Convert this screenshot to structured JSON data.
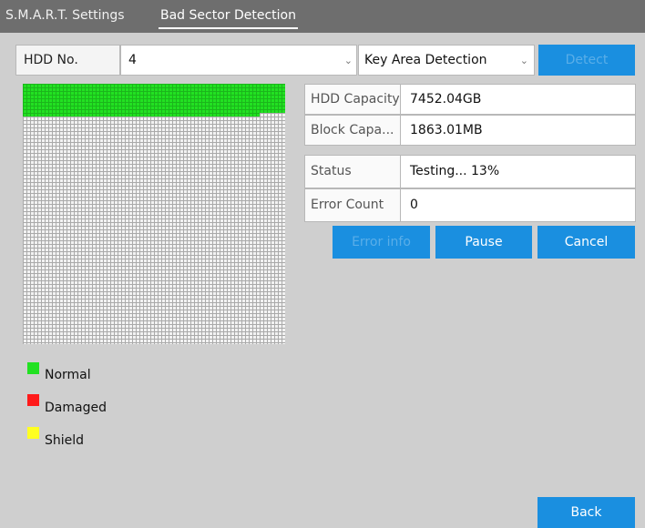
{
  "tabs": [
    {
      "label": "S.M.A.R.T. Settings",
      "active": false
    },
    {
      "label": "Bad Sector Detection",
      "active": true
    }
  ],
  "toolbar": {
    "hdd_no_label": "HDD No.",
    "hdd_no_value": "4",
    "detection_type": "Key Area Detection",
    "detect_button": "Detect"
  },
  "info": {
    "hdd_capacity_label": "HDD Capacity",
    "hdd_capacity_value": "7452.04GB",
    "block_capacity_label": "Block Capa...",
    "block_capacity_value": "1863.01MB",
    "status_label": "Status",
    "status_value": "Testing... 13%",
    "error_count_label": "Error Count",
    "error_count_value": "0"
  },
  "progress": {
    "fraction_tested": 0.13
  },
  "actions": {
    "error_info": "Error info",
    "pause": "Pause",
    "cancel": "Cancel"
  },
  "legend": [
    {
      "label": "Normal",
      "color": "#22e122"
    },
    {
      "label": "Damaged",
      "color": "#ff1a1a"
    },
    {
      "label": "Shield",
      "color": "#ffff22"
    }
  ],
  "footer": {
    "back": "Back"
  },
  "colors": {
    "accent": "#1a8fe0",
    "tabbar": "#6e6e6e",
    "background": "#cfcfcf"
  }
}
